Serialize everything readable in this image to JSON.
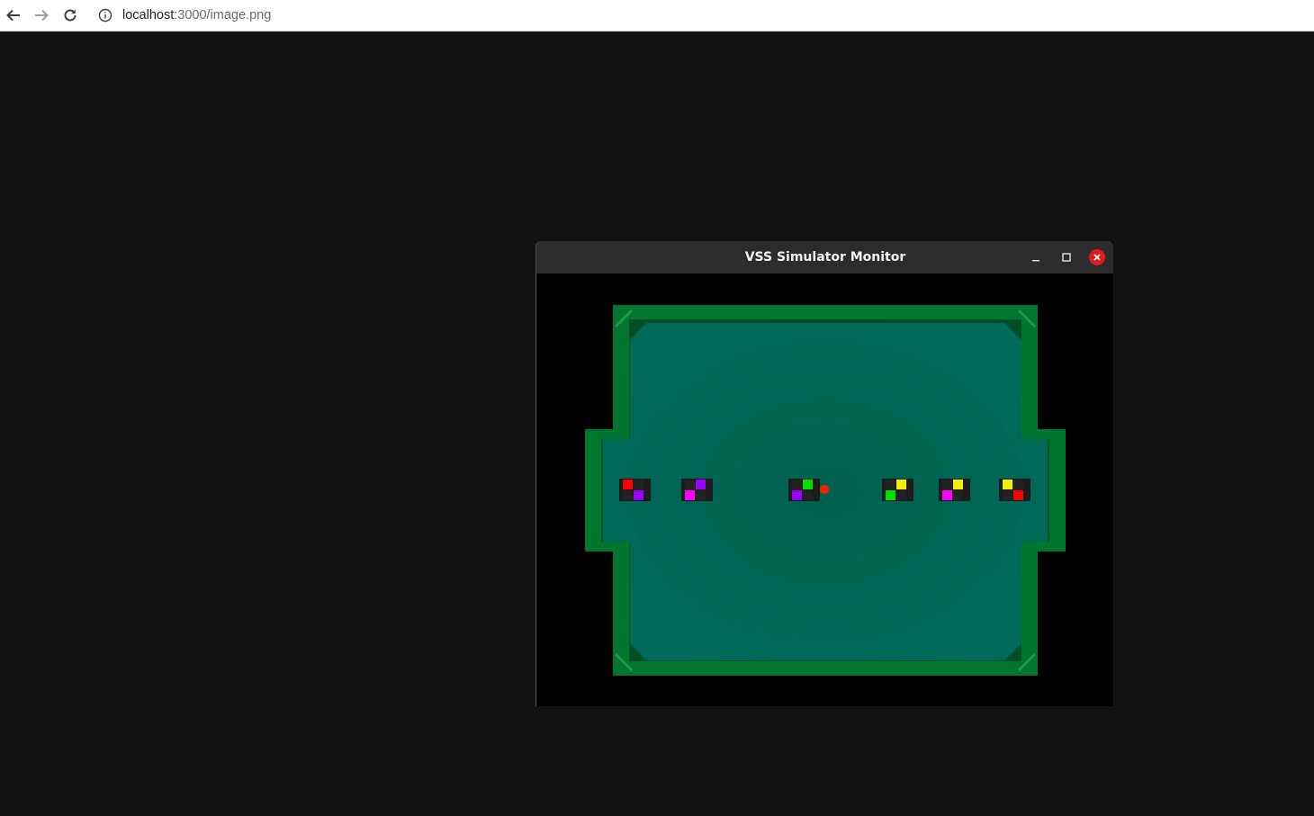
{
  "browser": {
    "url_host": "localhost",
    "url_path": ":3000/image.png",
    "icons": [
      "back-arrow-icon",
      "forward-arrow-icon",
      "reload-icon",
      "info-icon"
    ]
  },
  "window": {
    "title": "VSS Simulator Monitor",
    "controls": [
      "minimize-icon",
      "maximize-icon",
      "close-icon"
    ],
    "close_color": "#e01b1b"
  },
  "field": {
    "surface_color": "#006454",
    "wall_color": "#00762e",
    "background_color": "#000000"
  },
  "robots": [
    {
      "id": "robot-1",
      "colors": [
        "#ff0000",
        "#222222",
        "#222222",
        "#9b00ff"
      ]
    },
    {
      "id": "robot-2",
      "colors": [
        "#222222",
        "#9b00ff",
        "#ff00ff",
        "#222222"
      ]
    },
    {
      "id": "robot-3",
      "colors": [
        "#222222",
        "#00e000",
        "#9b00ff",
        "#222222"
      ]
    },
    {
      "id": "robot-4",
      "colors": [
        "#222222",
        "#f0f000",
        "#00e000",
        "#222222"
      ]
    },
    {
      "id": "robot-5",
      "colors": [
        "#222222",
        "#f0f000",
        "#ff00ff",
        "#222222"
      ]
    },
    {
      "id": "robot-6",
      "colors": [
        "#f0f000",
        "#222222",
        "#222222",
        "#ff0000"
      ]
    }
  ],
  "ball": {
    "color": "#ff2000"
  }
}
